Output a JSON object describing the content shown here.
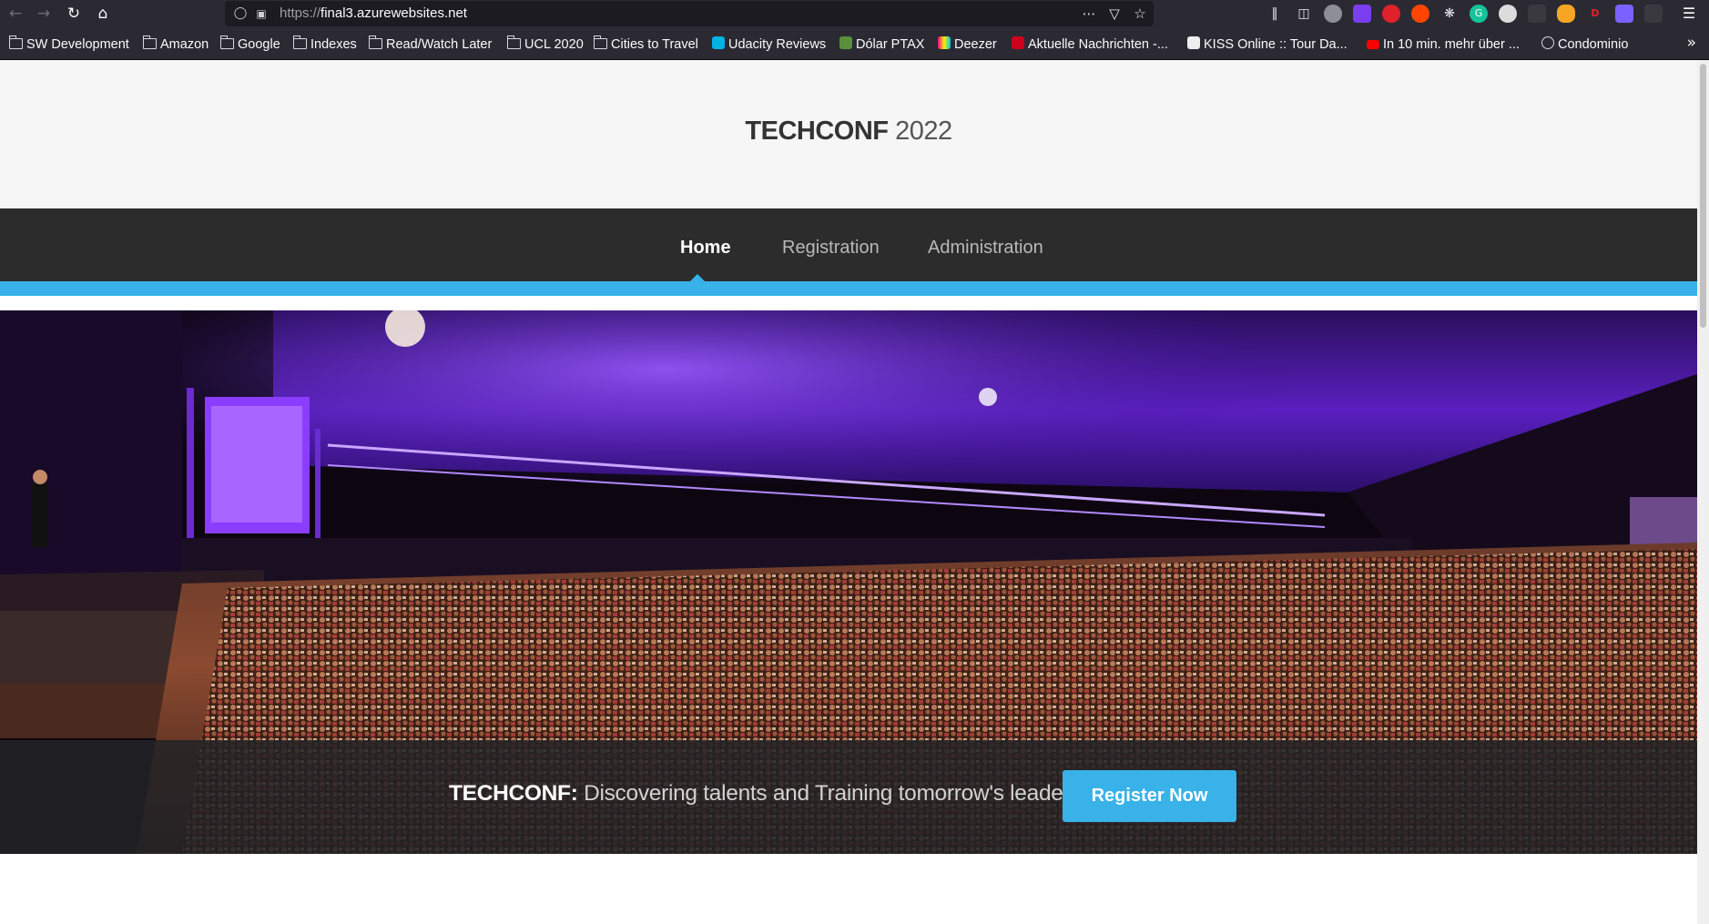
{
  "browser": {
    "url_scheme": "https://",
    "url_host": "final3.azurewebsites.net",
    "bookmarks": [
      {
        "label": "SW Development",
        "icon": "folder-icon"
      },
      {
        "label": "Amazon",
        "icon": "folder-icon"
      },
      {
        "label": "Google",
        "icon": "folder-icon"
      },
      {
        "label": "Indexes",
        "icon": "folder-icon"
      },
      {
        "label": "Read/Watch Later",
        "icon": "folder-icon"
      },
      {
        "label": "UCL 2020",
        "icon": "folder-icon"
      },
      {
        "label": "Cities to Travel",
        "icon": "folder-icon"
      },
      {
        "label": "Udacity Reviews",
        "icon": "udacity-icon"
      },
      {
        "label": "Dólar PTAX",
        "icon": "chart-favicon"
      },
      {
        "label": "Deezer",
        "icon": "deezer-icon"
      },
      {
        "label": "Aktuelle Nachrichten -...",
        "icon": "news-favicon"
      },
      {
        "label": "KISS Online :: Tour Da...",
        "icon": "kiss-favicon"
      },
      {
        "label": "In 10 min. mehr über ...",
        "icon": "youtube-icon"
      },
      {
        "label": "Condominio",
        "icon": "globe-icon"
      }
    ]
  },
  "site": {
    "title_bold": "TECHCONF",
    "title_light": " 2022",
    "nav": {
      "home": "Home",
      "registration": "Registration",
      "administration": "Administration"
    },
    "banner": {
      "brand": "TECHCONF:",
      "tagline": " Discovering talents and Training tomorrow's leaders",
      "cta": "Register Now"
    }
  },
  "colors": {
    "accent": "#38b2e8",
    "navbar": "#2c2c2c",
    "header_bg": "#f6f6f6"
  }
}
